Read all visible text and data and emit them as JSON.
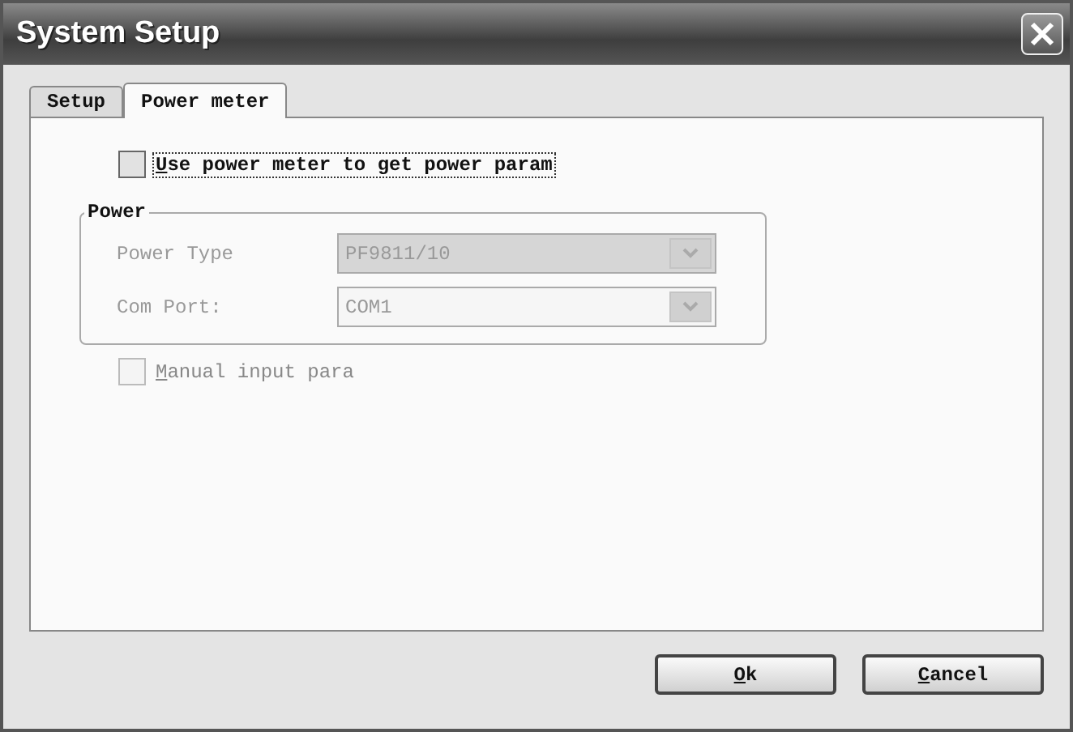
{
  "window": {
    "title": "System Setup"
  },
  "tabs": [
    {
      "label": "Setup",
      "selected": false
    },
    {
      "label": "Power meter",
      "selected": true
    }
  ],
  "use_power_meter": {
    "label": "Use power meter to get power param",
    "first_letter_underlined": true,
    "checked": false,
    "focused": true,
    "disabled": false
  },
  "power_group": {
    "title": "Power",
    "fields": [
      {
        "label": "Power Type",
        "value": "PF9811/10",
        "disabled": true,
        "editable": false
      },
      {
        "label": "Com Port:",
        "value": "COM1",
        "disabled": true,
        "editable": true
      }
    ]
  },
  "manual_input": {
    "label": "Manual input para",
    "first_letter_underlined": true,
    "checked": false,
    "disabled": true
  },
  "buttons": [
    {
      "label": "Ok",
      "first_letter_underlined": true
    },
    {
      "label": "Cancel",
      "first_letter_underlined": true
    }
  ]
}
